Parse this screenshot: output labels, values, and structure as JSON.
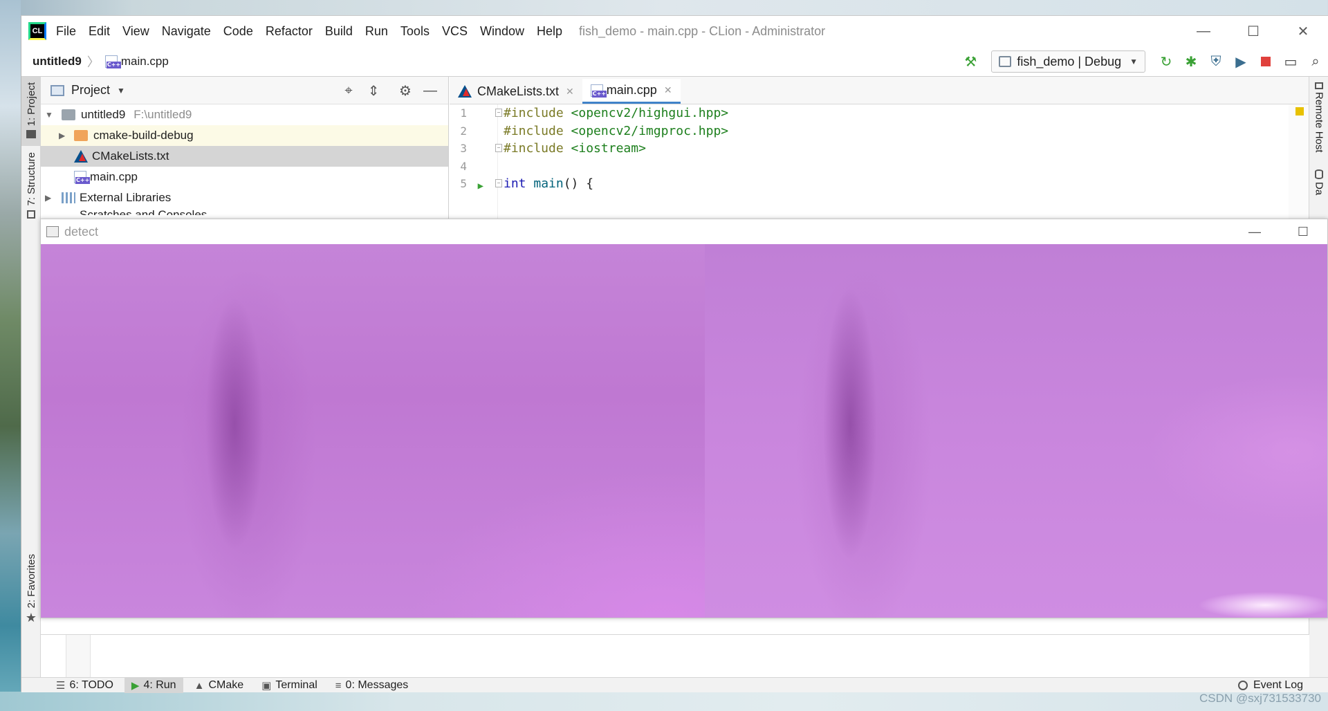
{
  "window": {
    "app_logo": "CL",
    "title": "fish_demo - main.cpp - CLion - Administrator",
    "menu": [
      "File",
      "Edit",
      "View",
      "Navigate",
      "Code",
      "Refactor",
      "Build",
      "Run",
      "Tools",
      "VCS",
      "Window",
      "Help"
    ],
    "controls": {
      "minimize": "—",
      "maximize": "☐",
      "close": "✕"
    }
  },
  "navbar": {
    "project": "untitled9",
    "file": "main.cpp",
    "run_config": "fish_demo | Debug",
    "icons": [
      "build-hammer-icon",
      "rerun-icon",
      "debug-icon",
      "coverage-icon",
      "profile-icon",
      "stop-icon",
      "run-anything-icon",
      "search-icon"
    ]
  },
  "left_stripe": {
    "project_tab": "1: Project",
    "structure_tab": "7: Structure",
    "favorites_tab": "2: Favorites"
  },
  "right_stripe": {
    "remote_host": "Remote Host",
    "database": "Da"
  },
  "project_panel": {
    "title": "Project",
    "tree": [
      {
        "name": "untitled9",
        "path": "F:\\untitled9"
      },
      {
        "name": "cmake-build-debug"
      },
      {
        "name": "CMakeLists.txt"
      },
      {
        "name": "main.cpp"
      },
      {
        "name": "External Libraries"
      },
      {
        "name": "Scratches and Consoles"
      }
    ]
  },
  "editor": {
    "tabs": [
      "CMakeLists.txt",
      "main.cpp"
    ],
    "active_tab": "main.cpp",
    "line_numbers": [
      "1",
      "2",
      "3",
      "4",
      "5"
    ],
    "lines": [
      {
        "directive": "#include",
        "arg": "<opencv2/highgui.hpp>"
      },
      {
        "directive": "#include",
        "arg": "<opencv2/imgproc.hpp>"
      },
      {
        "directive": "#include",
        "arg": "<iostream>"
      },
      {
        "directive": "",
        "arg": ""
      },
      {
        "kw": "int",
        "fn": "main",
        "rest": "() {"
      }
    ]
  },
  "detect_window": {
    "title": "detect",
    "controls": {
      "minimize": "—",
      "maximize": "☐"
    },
    "image_tint": "#c67fd9"
  },
  "bottom_bar": {
    "tabs": [
      {
        "label": "6: TODO",
        "icon": "list-icon"
      },
      {
        "label": "4: Run",
        "icon": "run-icon"
      },
      {
        "label": "CMake",
        "icon": "cmake-icon"
      },
      {
        "label": "Terminal",
        "icon": "terminal-icon"
      },
      {
        "label": "0: Messages",
        "icon": "messages-icon"
      }
    ],
    "active_tab": "4: Run",
    "event_log": "Event Log"
  },
  "watermark": "CSDN @sxj731533730",
  "colors": {
    "accent": "#4083c9",
    "run_green": "#3aa135",
    "stop_red": "#e0403c",
    "image_purple": "#c67fd9"
  }
}
